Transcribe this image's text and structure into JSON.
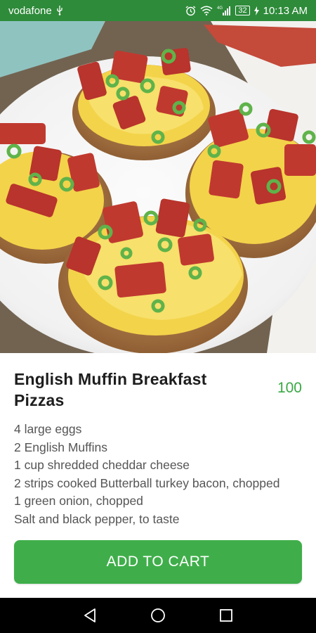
{
  "status_bar": {
    "carrier": "vodafone",
    "network": "4G",
    "battery": "32",
    "time": "10:13 AM",
    "icons": [
      "usb-icon",
      "alarm-icon",
      "wifi-icon",
      "signal-icon",
      "battery-icon",
      "charging-icon"
    ]
  },
  "hero": {
    "image_icon": "breakfast-pizza-photo"
  },
  "product": {
    "title": "English Muffin Breakfast Pizzas",
    "price": "100",
    "ingredients": [
      "4 large eggs",
      "2 English Muffins",
      "1 cup shredded cheddar cheese",
      "2 strips cooked Butterball turkey bacon, chopped",
      "1 green onion, chopped",
      "Salt and black pepper, to taste"
    ]
  },
  "actions": {
    "add_to_cart_label": "ADD TO CART"
  },
  "nav_bar": {
    "icons": [
      "back-icon",
      "home-icon",
      "recents-icon"
    ]
  },
  "colors": {
    "status_bar": "#2e8b3a",
    "accent": "#3fae4a",
    "price": "#3aa845",
    "title": "#1d1d1d",
    "body_text": "#555555"
  }
}
